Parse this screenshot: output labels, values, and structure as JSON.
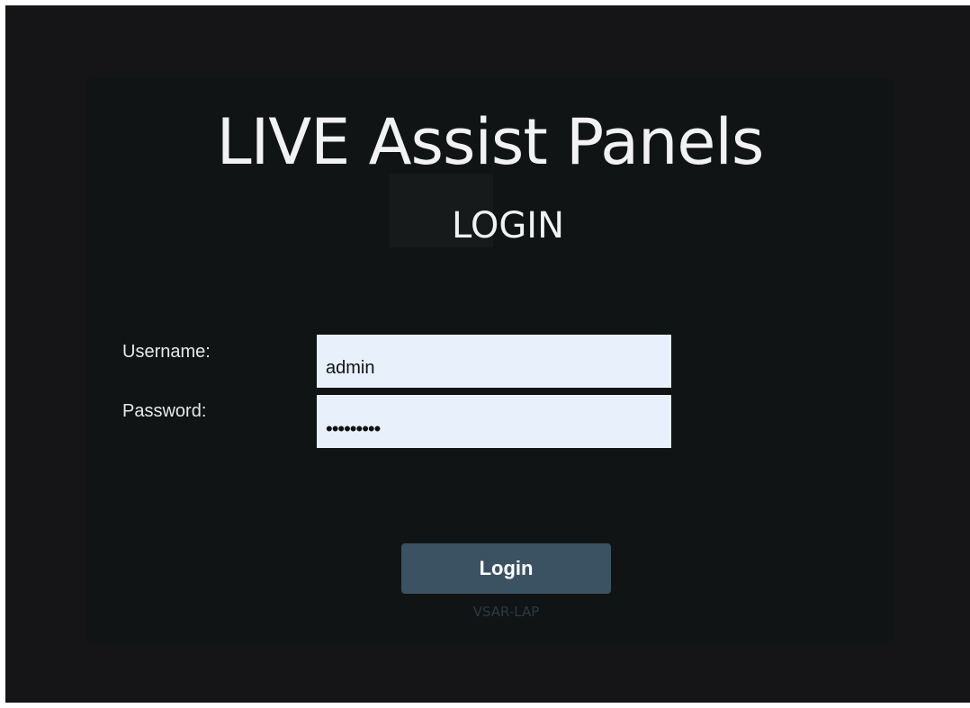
{
  "app_title": "LIVE Assist Panels",
  "login_heading": "LOGIN",
  "form": {
    "username_label": "Username:",
    "username_value": "admin",
    "password_label": "Password:",
    "password_value": "•••••••••",
    "login_button": "Login"
  },
  "host_name": "VSAR-LAP",
  "colors": {
    "background": "#151518",
    "panel": "#101414",
    "input_background": "#e8f0fb",
    "button": "#3b5263"
  }
}
